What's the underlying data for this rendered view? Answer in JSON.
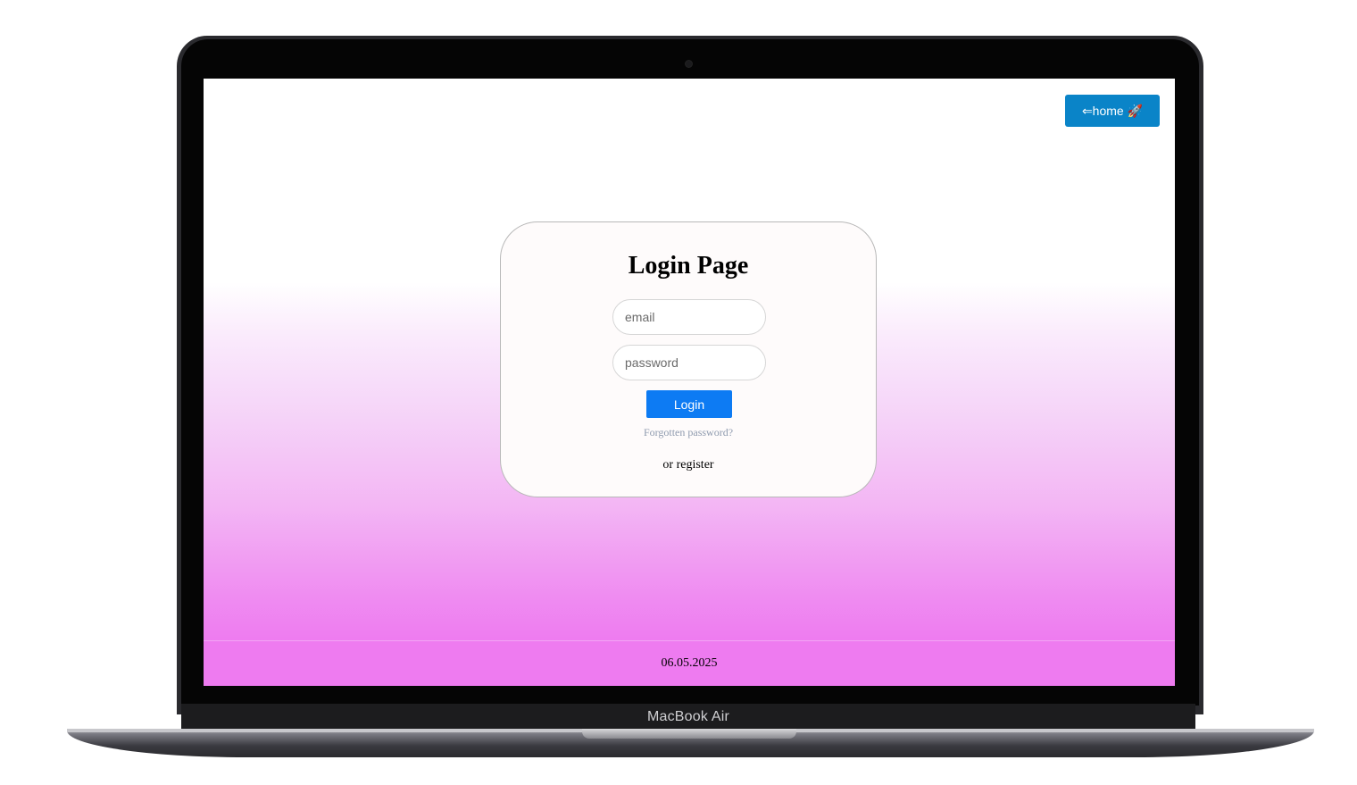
{
  "device": {
    "brand_label": "MacBook Air"
  },
  "nav": {
    "home_label": "⇐home 🚀"
  },
  "login": {
    "title": "Login Page",
    "email_placeholder": "email",
    "password_placeholder": "password",
    "submit_label": "Login",
    "forgot_label": "Forgotten password?",
    "register_label": "or register"
  },
  "footer": {
    "date": "06.05.2025"
  },
  "colors": {
    "home_button": "#0a84c8",
    "login_button": "#0d7bf3",
    "gradient_bottom": "#ee7bf0",
    "forgot_link": "#8e9aae"
  }
}
